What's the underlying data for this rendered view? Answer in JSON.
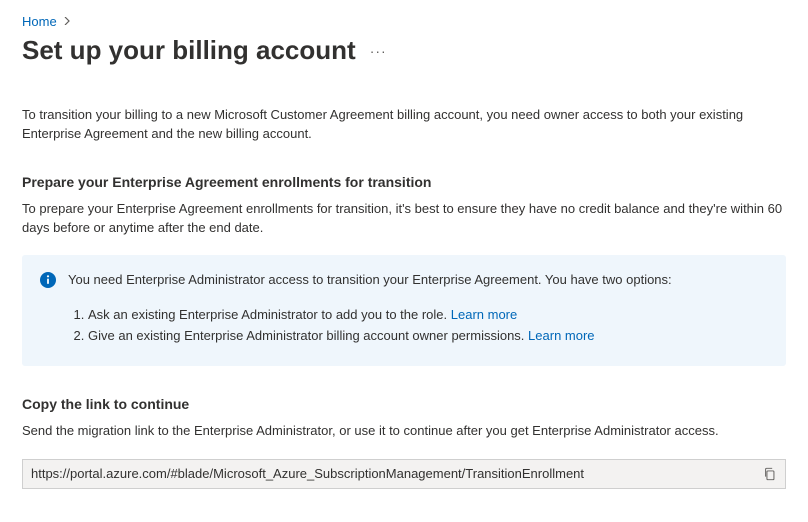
{
  "breadcrumb": {
    "home": "Home"
  },
  "title": "Set up your billing account",
  "intro": "To transition your billing to a new Microsoft Customer Agreement billing account, you need owner access to both your existing Enterprise Agreement and the new billing account.",
  "prepare": {
    "heading": "Prepare your Enterprise Agreement enrollments for transition",
    "body": "To prepare your Enterprise Agreement enrollments for transition, it's best to ensure they have no credit balance and they're within 60 days before or anytime after the end date."
  },
  "info": {
    "lead": "You need Enterprise Administrator access to transition your Enterprise Agreement. You have two options:",
    "items": [
      {
        "text": "Ask an existing Enterprise Administrator to add you to the role.",
        "link": "Learn more"
      },
      {
        "text": "Give an existing Enterprise Administrator billing account owner permissions.",
        "link": "Learn more"
      }
    ]
  },
  "copy": {
    "heading": "Copy the link to continue",
    "desc": "Send the migration link to the Enterprise Administrator, or use it to continue after you get Enterprise Administrator access.",
    "url": "https://portal.azure.com/#blade/Microsoft_Azure_SubscriptionManagement/TransitionEnrollment"
  }
}
